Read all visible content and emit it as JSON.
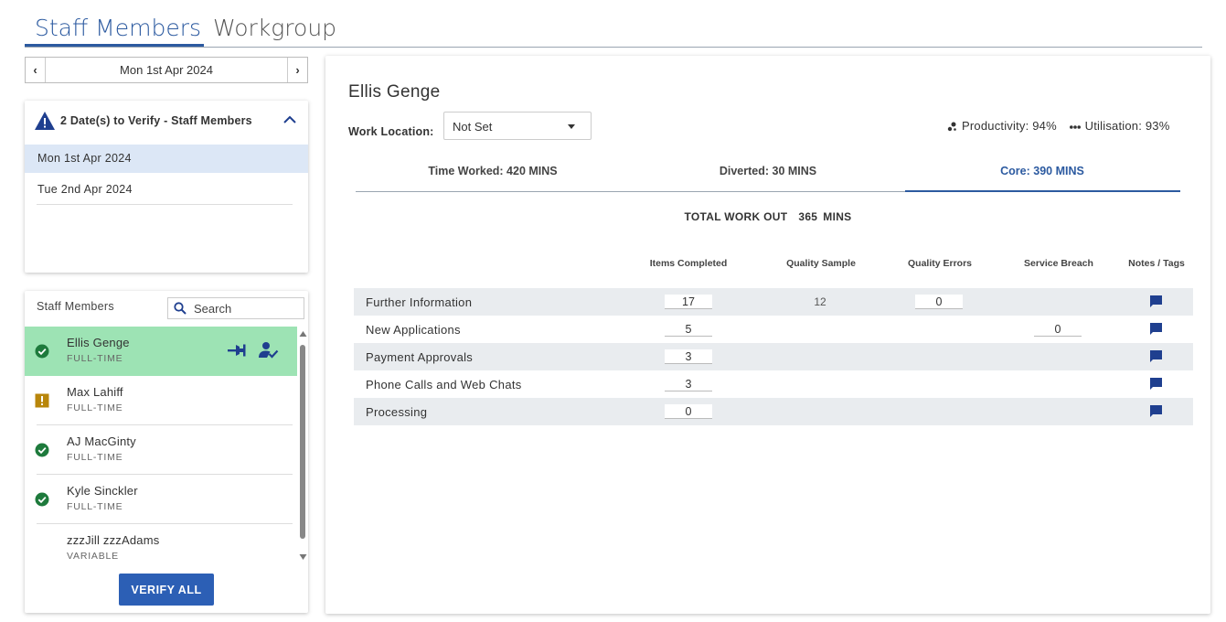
{
  "top_tabs": [
    "Staff Members",
    "Workgroup"
  ],
  "date_nav": {
    "current": "Mon 1st Apr 2024",
    "prev": "‹",
    "next": "›"
  },
  "verify": {
    "title": "2 Date(s) to Verify - Staff Members",
    "dates": [
      "Mon 1st Apr 2024",
      "Tue 2nd Apr 2024"
    ]
  },
  "staff": {
    "label": "Staff Members",
    "search_placeholder": "Search",
    "members": [
      {
        "name": "Ellis Genge",
        "type": "FULL-TIME",
        "status": "verified"
      },
      {
        "name": "Max Lahiff",
        "type": "FULL-TIME",
        "status": "warning"
      },
      {
        "name": "AJ MacGinty",
        "type": "FULL-TIME",
        "status": "verified"
      },
      {
        "name": "Kyle Sinckler",
        "type": "FULL-TIME",
        "status": "verified"
      },
      {
        "name": "zzzJill zzzAdams",
        "type": "VARIABLE",
        "status": "none"
      }
    ],
    "verify_all": "VERIFY ALL"
  },
  "main": {
    "name": "Ellis Genge",
    "work_location_label": "Work Location:",
    "work_location_value": "Not Set",
    "productivity": "Productivity: 94%",
    "utilisation": "Utilisation: 93%",
    "subtabs": [
      "Time Worked: 420 MINS",
      "Diverted: 30 MINS",
      "Core: 390 MINS"
    ],
    "total_label": "TOTAL WORK OUT",
    "total_value": "365",
    "total_unit": "MINS",
    "columns": [
      "Items Completed",
      "Quality Sample",
      "Quality Errors",
      "Service Breach",
      "Notes / Tags"
    ],
    "rows": [
      {
        "name": "Further Information",
        "items": "17",
        "quality_sample": "12",
        "quality_errors": "0",
        "service_breach": ""
      },
      {
        "name": "New Applications",
        "items": "5",
        "quality_sample": "",
        "quality_errors": "",
        "service_breach": "0"
      },
      {
        "name": "Payment Approvals",
        "items": "3",
        "quality_sample": "",
        "quality_errors": "",
        "service_breach": ""
      },
      {
        "name": "Phone Calls and Web Chats",
        "items": "3",
        "quality_sample": "",
        "quality_errors": "",
        "service_breach": ""
      },
      {
        "name": "Processing",
        "items": "0",
        "quality_sample": "",
        "quality_errors": "",
        "service_breach": ""
      }
    ]
  },
  "colors": {
    "accent": "#2c5aa0",
    "active_row": "#9de3b4",
    "selected_date": "#dce7f6",
    "verified": "#1e7a3c",
    "warning": "#b8860b",
    "button": "#2c5fb5"
  },
  "icons": [
    "warning-icon",
    "chevron-up-icon",
    "search-icon",
    "check-circle-icon",
    "exclamation-icon",
    "pin-icon",
    "user-verify-icon",
    "productivity-icon",
    "utilisation-icon",
    "note-icon"
  ]
}
